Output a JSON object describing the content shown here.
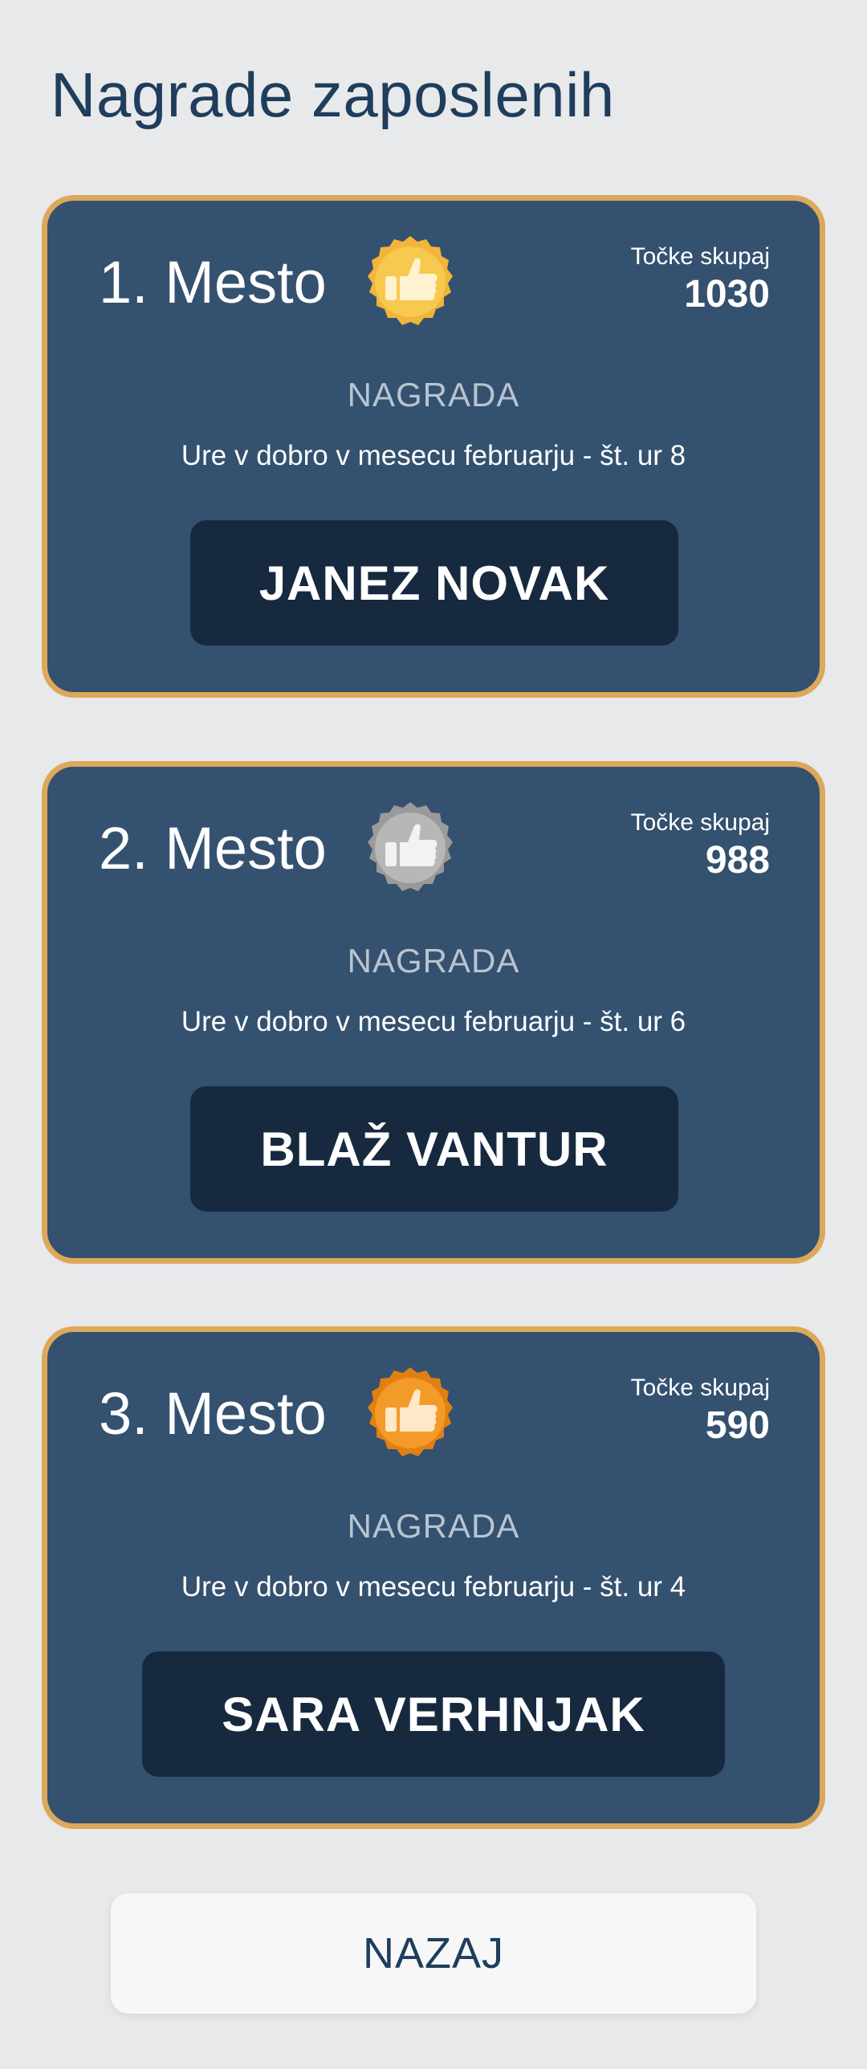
{
  "page": {
    "title": "Nagrade zaposlenih"
  },
  "rankings": [
    {
      "place": "1. Mesto",
      "points_label": "Točke skupaj",
      "points": "1030",
      "prize_label": "NAGRADA",
      "prize": "Ure v dobro v mesecu februarju - št. ur 8",
      "employee": "JANEZ NOVAK",
      "medal": "gold-thumbs-up-medal-icon",
      "medal_colors": {
        "outer": "#f2b43a",
        "inner": "#f7c94f",
        "glyph": "#fff3cf"
      }
    },
    {
      "place": "2. Mesto",
      "points_label": "Točke skupaj",
      "points": "988",
      "prize_label": "NAGRADA",
      "prize": "Ure v dobro v mesecu februarju - št. ur 6",
      "employee": "BLAŽ VANTUR",
      "medal": "silver-thumbs-up-medal-icon",
      "medal_colors": {
        "outer": "#9a9a9a",
        "inner": "#b7b7b7",
        "glyph": "#f2f2f2"
      }
    },
    {
      "place": "3. Mesto",
      "points_label": "Točke skupaj",
      "points": "590",
      "prize_label": "NAGRADA",
      "prize": "Ure v dobro v mesecu februarju - št. ur 4",
      "employee": "SARA VERHNJAK",
      "medal": "bronze-thumbs-up-medal-icon",
      "medal_colors": {
        "outer": "#e27f13",
        "inner": "#f39a28",
        "glyph": "#ffe8c8"
      }
    }
  ],
  "footer": {
    "back_label": "NAZAJ"
  },
  "colors": {
    "background": "#e8e9eb",
    "card": "#34516f",
    "card_border": "#dca85a",
    "name_plate": "#17293f",
    "title": "#1f3d5c"
  }
}
